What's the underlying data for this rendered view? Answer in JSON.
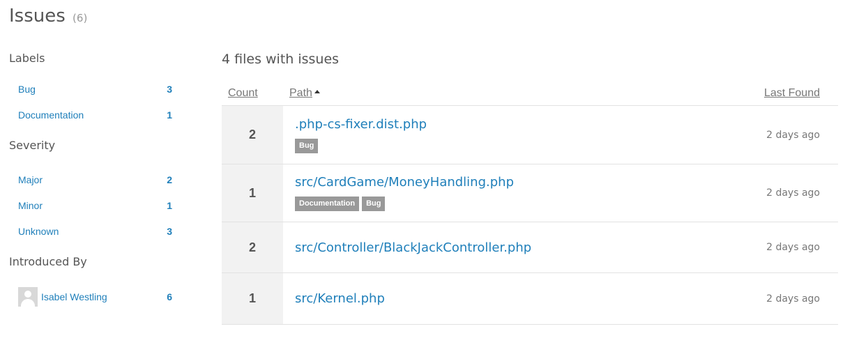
{
  "page": {
    "title": "Issues",
    "count": "(6)"
  },
  "sidebar": {
    "labels_heading": "Labels",
    "labels": [
      {
        "label": "Bug",
        "count": "3"
      },
      {
        "label": "Documentation",
        "count": "1"
      }
    ],
    "severity_heading": "Severity",
    "severity": [
      {
        "label": "Major",
        "count": "2"
      },
      {
        "label": "Minor",
        "count": "1"
      },
      {
        "label": "Unknown",
        "count": "3"
      }
    ],
    "introduced_heading": "Introduced By",
    "introduced": [
      {
        "label": "Isabel Westling",
        "count": "6"
      }
    ]
  },
  "main": {
    "heading": "4 files with issues",
    "columns": {
      "count": "Count",
      "path": "Path",
      "last_found": "Last Found"
    },
    "rows": [
      {
        "count": "2",
        "path": ".php-cs-fixer.dist.php",
        "tags": [
          "Bug"
        ],
        "last_found": "2 days ago"
      },
      {
        "count": "1",
        "path": "src/CardGame/MoneyHandling.php",
        "tags": [
          "Documentation",
          "Bug"
        ],
        "last_found": "2 days ago"
      },
      {
        "count": "2",
        "path": "src/Controller/BlackJackController.php",
        "tags": [],
        "last_found": "2 days ago"
      },
      {
        "count": "1",
        "path": "src/Kernel.php",
        "tags": [],
        "last_found": "2 days ago"
      }
    ]
  },
  "colors": {
    "link": "#1f7fba",
    "tag_bg": "#999999",
    "count_bg": "#f2f2f2"
  }
}
